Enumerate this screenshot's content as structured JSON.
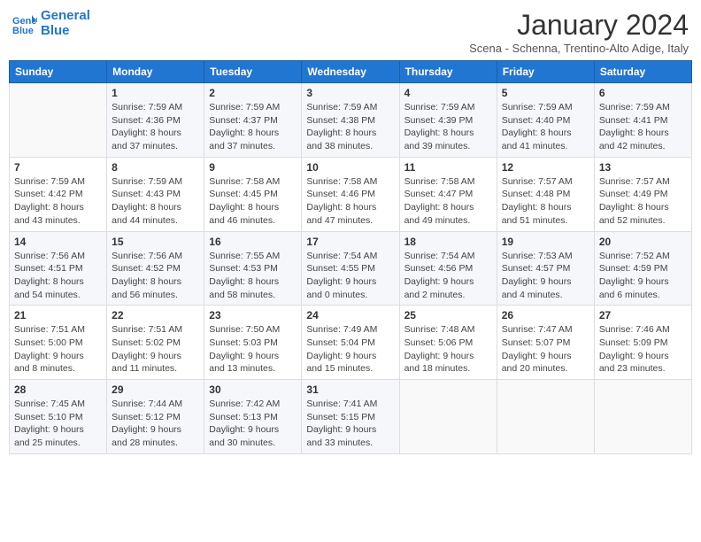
{
  "logo": {
    "line1": "General",
    "line2": "Blue"
  },
  "title": "January 2024",
  "subtitle": "Scena - Schenna, Trentino-Alto Adige, Italy",
  "weekdays": [
    "Sunday",
    "Monday",
    "Tuesday",
    "Wednesday",
    "Thursday",
    "Friday",
    "Saturday"
  ],
  "weeks": [
    [
      {
        "day": "",
        "info": ""
      },
      {
        "day": "1",
        "info": "Sunrise: 7:59 AM\nSunset: 4:36 PM\nDaylight: 8 hours\nand 37 minutes."
      },
      {
        "day": "2",
        "info": "Sunrise: 7:59 AM\nSunset: 4:37 PM\nDaylight: 8 hours\nand 37 minutes."
      },
      {
        "day": "3",
        "info": "Sunrise: 7:59 AM\nSunset: 4:38 PM\nDaylight: 8 hours\nand 38 minutes."
      },
      {
        "day": "4",
        "info": "Sunrise: 7:59 AM\nSunset: 4:39 PM\nDaylight: 8 hours\nand 39 minutes."
      },
      {
        "day": "5",
        "info": "Sunrise: 7:59 AM\nSunset: 4:40 PM\nDaylight: 8 hours\nand 41 minutes."
      },
      {
        "day": "6",
        "info": "Sunrise: 7:59 AM\nSunset: 4:41 PM\nDaylight: 8 hours\nand 42 minutes."
      }
    ],
    [
      {
        "day": "7",
        "info": "Sunrise: 7:59 AM\nSunset: 4:42 PM\nDaylight: 8 hours\nand 43 minutes."
      },
      {
        "day": "8",
        "info": "Sunrise: 7:59 AM\nSunset: 4:43 PM\nDaylight: 8 hours\nand 44 minutes."
      },
      {
        "day": "9",
        "info": "Sunrise: 7:58 AM\nSunset: 4:45 PM\nDaylight: 8 hours\nand 46 minutes."
      },
      {
        "day": "10",
        "info": "Sunrise: 7:58 AM\nSunset: 4:46 PM\nDaylight: 8 hours\nand 47 minutes."
      },
      {
        "day": "11",
        "info": "Sunrise: 7:58 AM\nSunset: 4:47 PM\nDaylight: 8 hours\nand 49 minutes."
      },
      {
        "day": "12",
        "info": "Sunrise: 7:57 AM\nSunset: 4:48 PM\nDaylight: 8 hours\nand 51 minutes."
      },
      {
        "day": "13",
        "info": "Sunrise: 7:57 AM\nSunset: 4:49 PM\nDaylight: 8 hours\nand 52 minutes."
      }
    ],
    [
      {
        "day": "14",
        "info": "Sunrise: 7:56 AM\nSunset: 4:51 PM\nDaylight: 8 hours\nand 54 minutes."
      },
      {
        "day": "15",
        "info": "Sunrise: 7:56 AM\nSunset: 4:52 PM\nDaylight: 8 hours\nand 56 minutes."
      },
      {
        "day": "16",
        "info": "Sunrise: 7:55 AM\nSunset: 4:53 PM\nDaylight: 8 hours\nand 58 minutes."
      },
      {
        "day": "17",
        "info": "Sunrise: 7:54 AM\nSunset: 4:55 PM\nDaylight: 9 hours\nand 0 minutes."
      },
      {
        "day": "18",
        "info": "Sunrise: 7:54 AM\nSunset: 4:56 PM\nDaylight: 9 hours\nand 2 minutes."
      },
      {
        "day": "19",
        "info": "Sunrise: 7:53 AM\nSunset: 4:57 PM\nDaylight: 9 hours\nand 4 minutes."
      },
      {
        "day": "20",
        "info": "Sunrise: 7:52 AM\nSunset: 4:59 PM\nDaylight: 9 hours\nand 6 minutes."
      }
    ],
    [
      {
        "day": "21",
        "info": "Sunrise: 7:51 AM\nSunset: 5:00 PM\nDaylight: 9 hours\nand 8 minutes."
      },
      {
        "day": "22",
        "info": "Sunrise: 7:51 AM\nSunset: 5:02 PM\nDaylight: 9 hours\nand 11 minutes."
      },
      {
        "day": "23",
        "info": "Sunrise: 7:50 AM\nSunset: 5:03 PM\nDaylight: 9 hours\nand 13 minutes."
      },
      {
        "day": "24",
        "info": "Sunrise: 7:49 AM\nSunset: 5:04 PM\nDaylight: 9 hours\nand 15 minutes."
      },
      {
        "day": "25",
        "info": "Sunrise: 7:48 AM\nSunset: 5:06 PM\nDaylight: 9 hours\nand 18 minutes."
      },
      {
        "day": "26",
        "info": "Sunrise: 7:47 AM\nSunset: 5:07 PM\nDaylight: 9 hours\nand 20 minutes."
      },
      {
        "day": "27",
        "info": "Sunrise: 7:46 AM\nSunset: 5:09 PM\nDaylight: 9 hours\nand 23 minutes."
      }
    ],
    [
      {
        "day": "28",
        "info": "Sunrise: 7:45 AM\nSunset: 5:10 PM\nDaylight: 9 hours\nand 25 minutes."
      },
      {
        "day": "29",
        "info": "Sunrise: 7:44 AM\nSunset: 5:12 PM\nDaylight: 9 hours\nand 28 minutes."
      },
      {
        "day": "30",
        "info": "Sunrise: 7:42 AM\nSunset: 5:13 PM\nDaylight: 9 hours\nand 30 minutes."
      },
      {
        "day": "31",
        "info": "Sunrise: 7:41 AM\nSunset: 5:15 PM\nDaylight: 9 hours\nand 33 minutes."
      },
      {
        "day": "",
        "info": ""
      },
      {
        "day": "",
        "info": ""
      },
      {
        "day": "",
        "info": ""
      }
    ]
  ]
}
